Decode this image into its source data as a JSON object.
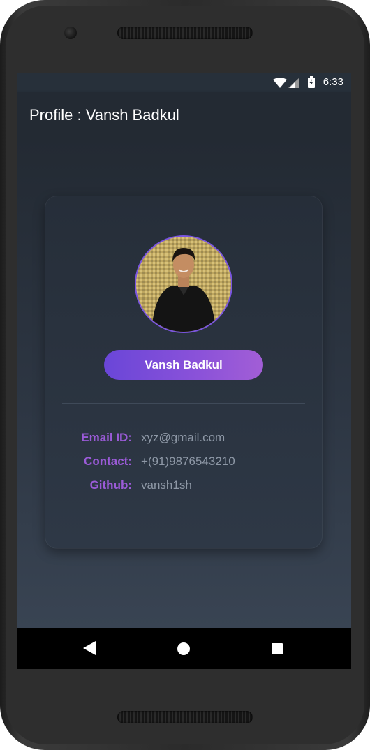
{
  "status_bar": {
    "time": "6:33",
    "icons": [
      "wifi-icon",
      "signal-icon",
      "battery-charging-icon"
    ]
  },
  "app_bar": {
    "title": "Profile : Vansh Badkul"
  },
  "profile_card": {
    "avatar": "profile-photo",
    "name": "Vansh Badkul",
    "fields": [
      {
        "label": "Email ID:",
        "value": "xyz@gmail.com"
      },
      {
        "label": "Contact:",
        "value": "+(91)9876543210"
      },
      {
        "label": "Github:",
        "value": "vansh1sh"
      }
    ]
  },
  "nav_bar": {
    "icons": [
      "back-icon",
      "home-icon",
      "recent-apps-icon"
    ]
  },
  "colors": {
    "accent_purple": "#9b5bd8",
    "button_gradient_start": "#6a46d8",
    "button_gradient_end": "#a25ed6",
    "screen_background": "#27303a",
    "value_text": "#8e98a6"
  }
}
